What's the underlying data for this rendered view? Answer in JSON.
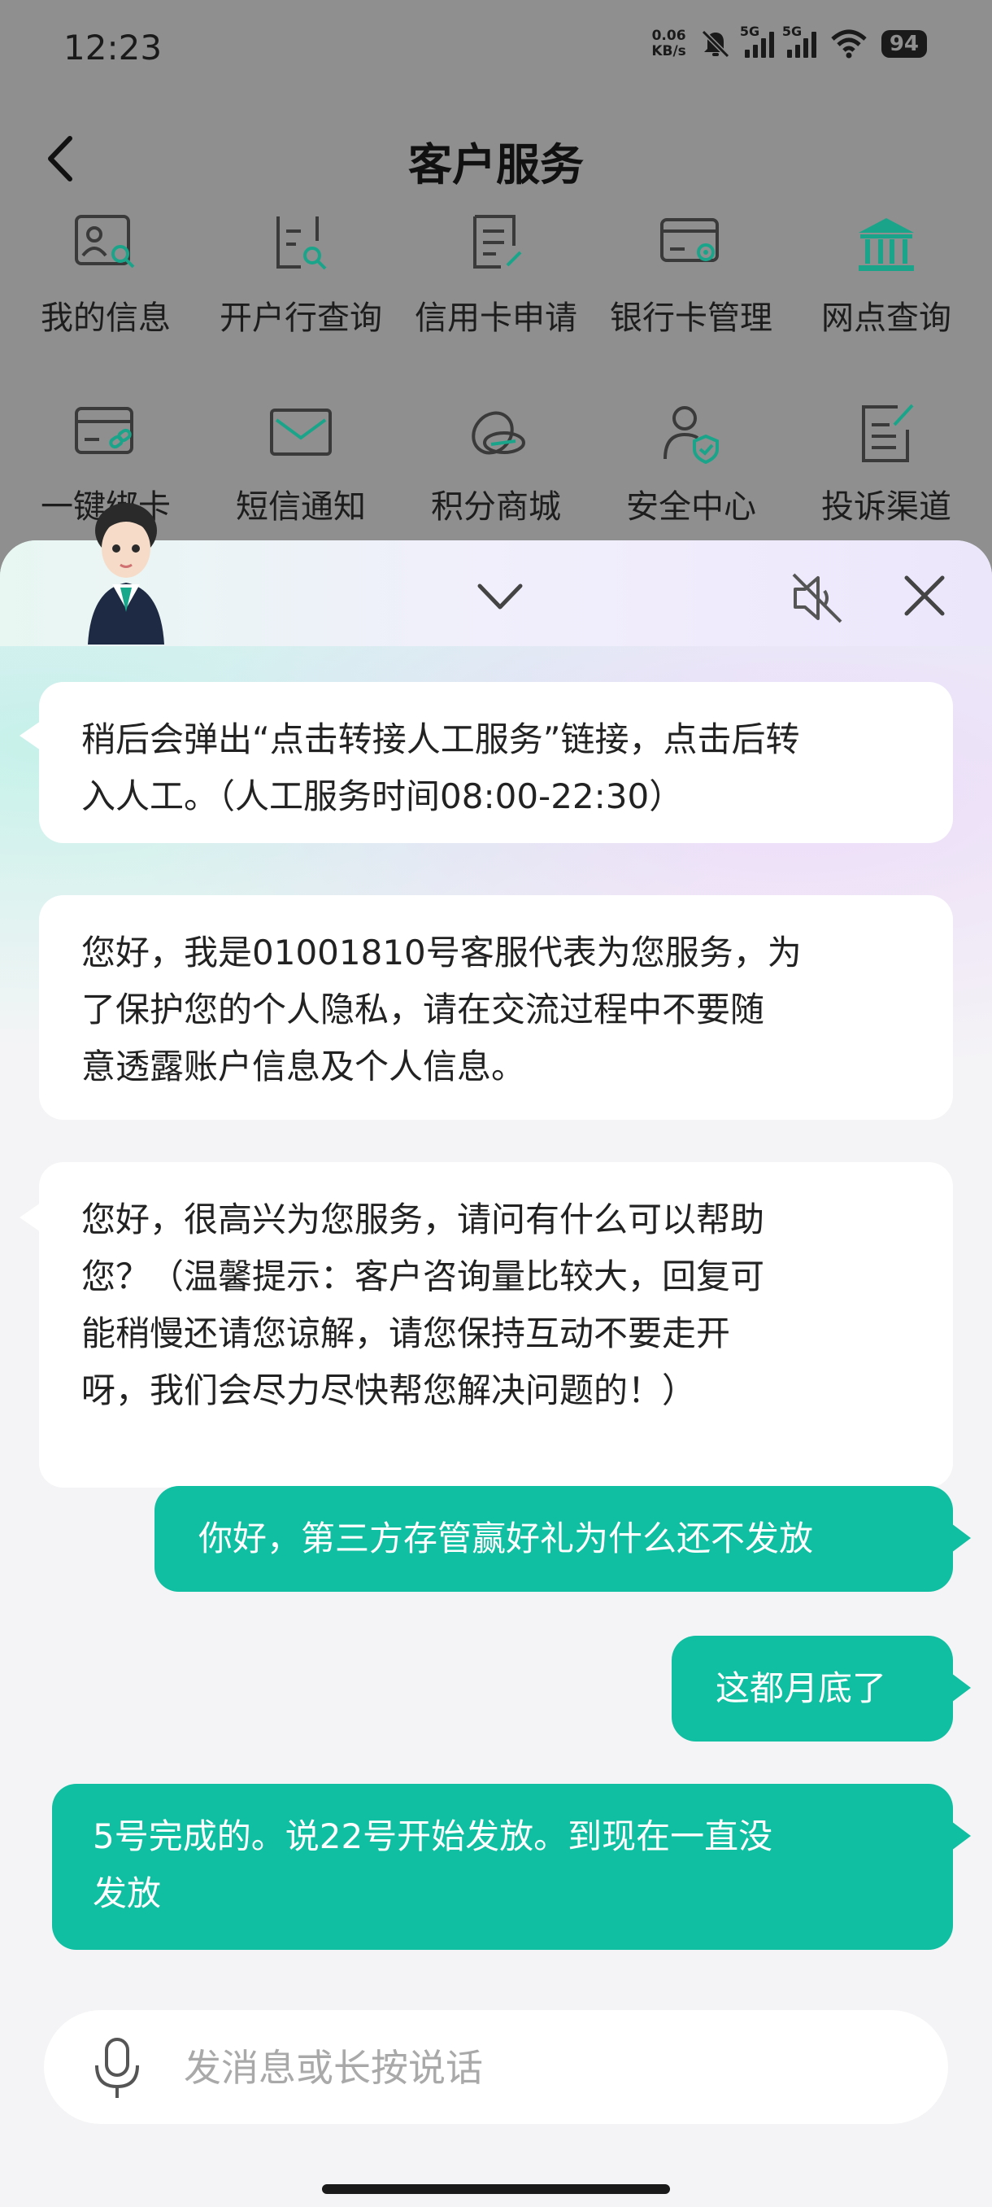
{
  "status_bar": {
    "time": "12:23",
    "net_speed_value": "0.06",
    "net_speed_unit": "KB/s",
    "signal1_label": "5G",
    "signal2_label": "5G",
    "battery": "94"
  },
  "header": {
    "title": "客户服务"
  },
  "services": [
    {
      "label": "我的信息",
      "icon": "profile-search-icon"
    },
    {
      "label": "开户行查询",
      "icon": "bank-search-icon"
    },
    {
      "label": "信用卡申请",
      "icon": "form-edit-icon"
    },
    {
      "label": "银行卡管理",
      "icon": "card-settings-icon"
    },
    {
      "label": "网点查询",
      "icon": "bank-building-icon"
    },
    {
      "label": "一键绑卡",
      "icon": "card-link-icon"
    },
    {
      "label": "短信通知",
      "icon": "envelope-icon"
    },
    {
      "label": "积分商城",
      "icon": "coins-icon"
    },
    {
      "label": "安全中心",
      "icon": "user-shield-icon"
    },
    {
      "label": "投诉渠道",
      "icon": "document-edit-icon"
    }
  ],
  "chat": {
    "messages": [
      {
        "from": "agent",
        "lines": [
          "稍后会弹出“点击转接人工服务”链接，点击后转",
          "入人工。（人工服务时间08:00-22:30）"
        ]
      },
      {
        "from": "agent",
        "lines": [
          "您好，我是01001810号客服代表为您服务，为",
          "了保护您的个人隐私，请在交流过程中不要随",
          "意透露账户信息及个人信息。"
        ]
      },
      {
        "from": "agent",
        "lines": [
          "您好，很高兴为您服务，请问有什么可以帮助",
          "您？（温馨提示：客户咨询量比较大，回复可",
          "能稍慢还请您谅解，请您保持互动不要走开",
          "呀，我们会尽力尽快帮您解决问题的！）"
        ]
      },
      {
        "from": "user",
        "lines": [
          "你好，第三方存管赢好礼为什么还不发放"
        ]
      },
      {
        "from": "user",
        "lines": [
          "这都月底了"
        ]
      },
      {
        "from": "user",
        "lines": [
          "5号完成的。说22号开始发放。到现在一直没",
          "发放"
        ]
      }
    ]
  },
  "input": {
    "placeholder": "发消息或长按说话"
  },
  "colors": {
    "accent": "#10bfa1",
    "icon_green": "#1aa58a",
    "overlay": "#8f8f8f"
  }
}
